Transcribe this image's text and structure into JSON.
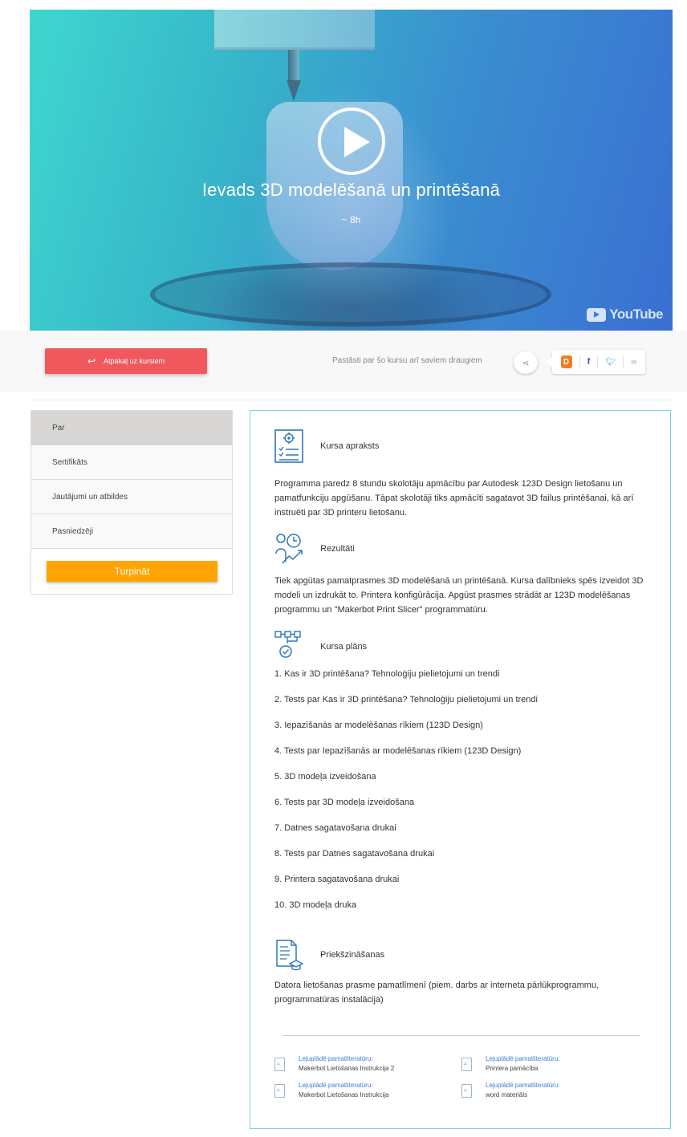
{
  "hero": {
    "title": "Ievads 3D modelēšanā un printēšanā",
    "duration": "~ 8h",
    "video_brand": "YouTube"
  },
  "action_bar": {
    "back_label": "Atpakaļ uz kursiem",
    "share_text": "Pastāsti par šo kursu arī saviem draugiem",
    "share_targets": [
      "draugiem",
      "facebook",
      "twitter",
      "link"
    ]
  },
  "sidebar": {
    "items": [
      {
        "label": "Par",
        "active": true
      },
      {
        "label": "Sertifikāts",
        "active": false
      },
      {
        "label": "Jautājumi un atbildes",
        "active": false
      },
      {
        "label": "Pasniedzēji",
        "active": false
      }
    ],
    "continue_label": "Turpināt"
  },
  "main": {
    "description": {
      "heading": "Kursa apraksts",
      "text": "Programma paredz 8 stundu skolotāju apmācību par Autodesk 123D Design lietošanu un pamatfunkciju apgūšanu. Tāpat skolotāji tiks apmācīti sagatavot 3D failus printēšanai, kā arī instruēti par 3D printeru lietošanu."
    },
    "results": {
      "heading": "Rezultāti",
      "text": "Tiek apgūtas pamatprasmes 3D modelēšanā un printēšanā. Kursa dalībnieks spēs izveidot 3D modeli un izdrukāt to. Printera konfigūrācija. Apgūst prasmes strādāt ar 123D modelēšanas programmu un \"Makerbot Print Slicer\" programmatūru."
    },
    "plan": {
      "heading": "Kursa plāns",
      "items": [
        "1.  Kas ir 3D printēšana? Tehnoloģiju pielietojumi un trendi",
        "2.  Tests par Kas ir 3D printēšana? Tehnoloģiju pielietojumi un trendi",
        "3.  Iepazīšanās ar modelēšanas rīkiem (123D Design)",
        "4.  Tests par Iepazīšanās ar modelēšanas rīkiem (123D Design)",
        "5.  3D modeļa izveidošana",
        "6.  Tests par 3D modeļa izveidošana",
        "7.  Datnes sagatavošana drukai",
        "8.  Tests par Datnes sagatavošana drukai",
        "9.  Printera sagatavošana drukai",
        "10.  3D modeļa druka"
      ]
    },
    "prerequisites": {
      "heading": "Priekšzināšanas",
      "text": "Datora lietošanas prasme pamatlīmenī (piem. darbs ar interneta pārlūkprogrammu, programmatūras instalācija)"
    },
    "downloads": [
      {
        "title": "Lejuplādē pamatliteratūru:",
        "name": "Makerbot Lietošanas Instrukcija 2"
      },
      {
        "title": "Lejuplādē pamatliteratūru:",
        "name": "Printera pamācība"
      },
      {
        "title": "Lejuplādē pamatliteratūru:",
        "name": "Makerbot Lietošanas Instrukcija"
      },
      {
        "title": "Lejuplādē pamatliteratūru:",
        "name": "word materiāls"
      }
    ]
  },
  "colors": {
    "back_button": "#f0585e",
    "continue_button": "#ffa400",
    "panel_border": "#7bd3e0",
    "link_blue": "#3b7ddd",
    "icon_blue": "#2f78b8"
  }
}
